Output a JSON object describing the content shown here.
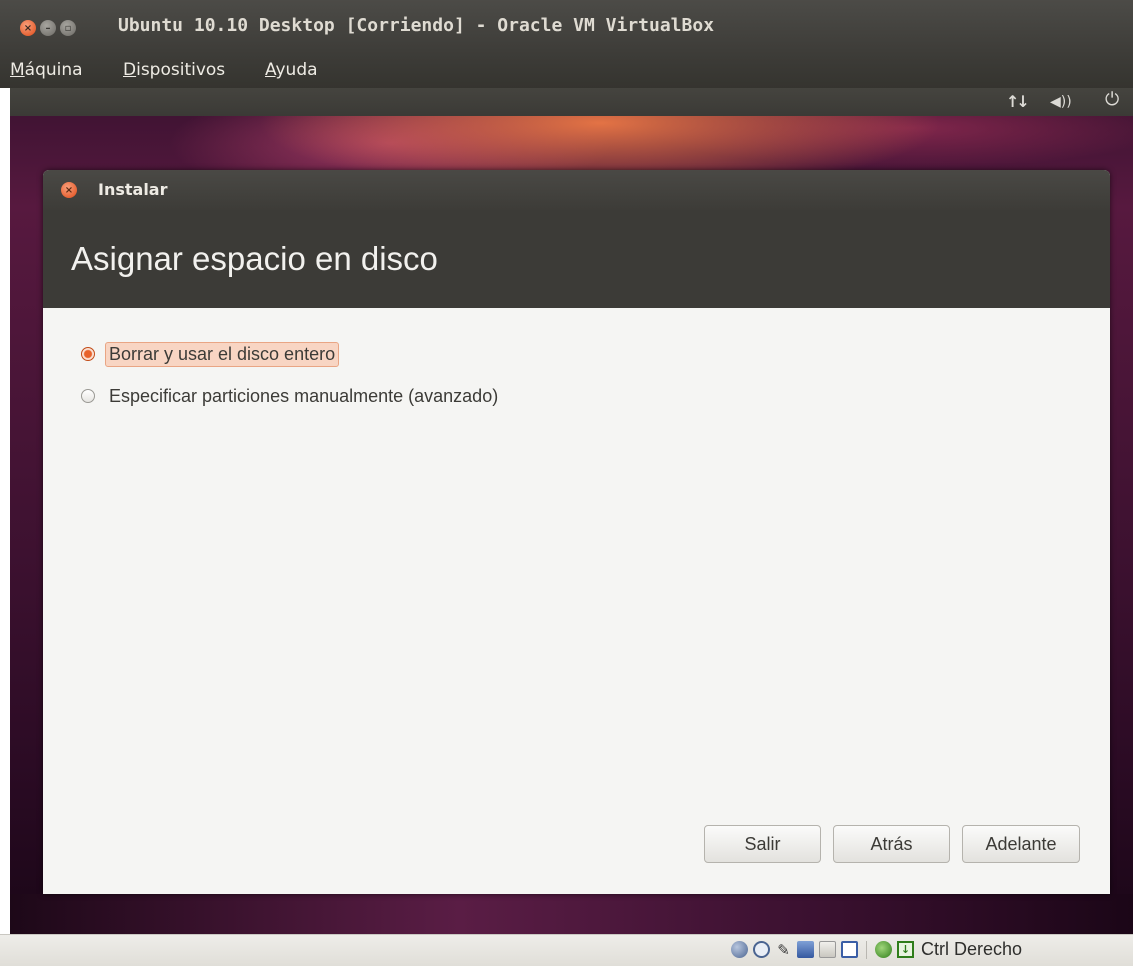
{
  "window": {
    "title": "Ubuntu 10.10 Desktop [Corriendo] - Oracle VM VirtualBox"
  },
  "menubar": {
    "items": [
      {
        "label": "Máquina"
      },
      {
        "label": "Dispositivos"
      },
      {
        "label": "Ayuda"
      }
    ]
  },
  "guest_panel": {
    "icons": [
      "network-icon",
      "volume-icon",
      "power-icon"
    ]
  },
  "installer": {
    "window_title": "Instalar",
    "page_title": "Asignar espacio en disco",
    "options": [
      {
        "label": "Borrar y usar el disco entero",
        "selected": true
      },
      {
        "label": "Especificar particiones manualmente (avanzado)",
        "selected": false
      }
    ],
    "buttons": {
      "quit": "Salir",
      "back": "Atrás",
      "forward": "Adelante"
    }
  },
  "statusbar": {
    "icons": [
      "hard-disk-icon",
      "optical-drive-icon",
      "usb-icon",
      "network-adapter-icon",
      "shared-folder-icon",
      "display-icon",
      "virtualization-icon",
      "mouse-integration-icon"
    ],
    "host_key": "Ctrl Derecho"
  },
  "colors": {
    "ubuntu_orange": "#dd4814",
    "header_dark": "#3c3b37",
    "content_bg": "#f5f5f3"
  }
}
